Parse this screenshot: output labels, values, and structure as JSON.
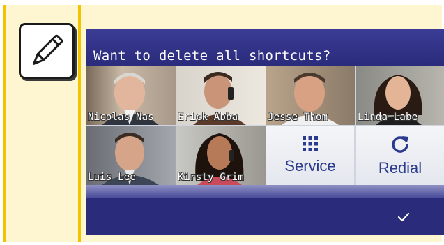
{
  "screen": {
    "prompt": "Want to delete all shortcuts?"
  },
  "contacts": [
    {
      "name": "Nicolas Nas"
    },
    {
      "name": "Erick Abba"
    },
    {
      "name": "Jesse Thom"
    },
    {
      "name": "Linda Labe"
    },
    {
      "name": "Luis Lee"
    },
    {
      "name": "Kirsty Grim"
    }
  ],
  "functions": [
    {
      "label": "Service",
      "icon": "grid-icon"
    },
    {
      "label": "Redial",
      "icon": "redial-icon"
    }
  ],
  "footer": {
    "confirm_icon": "checkmark-icon"
  },
  "colors": {
    "screen_bg": "#2a2b7b",
    "note_bg": "#fdf6d0",
    "note_accent": "#f2c400",
    "function_text": "#2a3a8c"
  }
}
